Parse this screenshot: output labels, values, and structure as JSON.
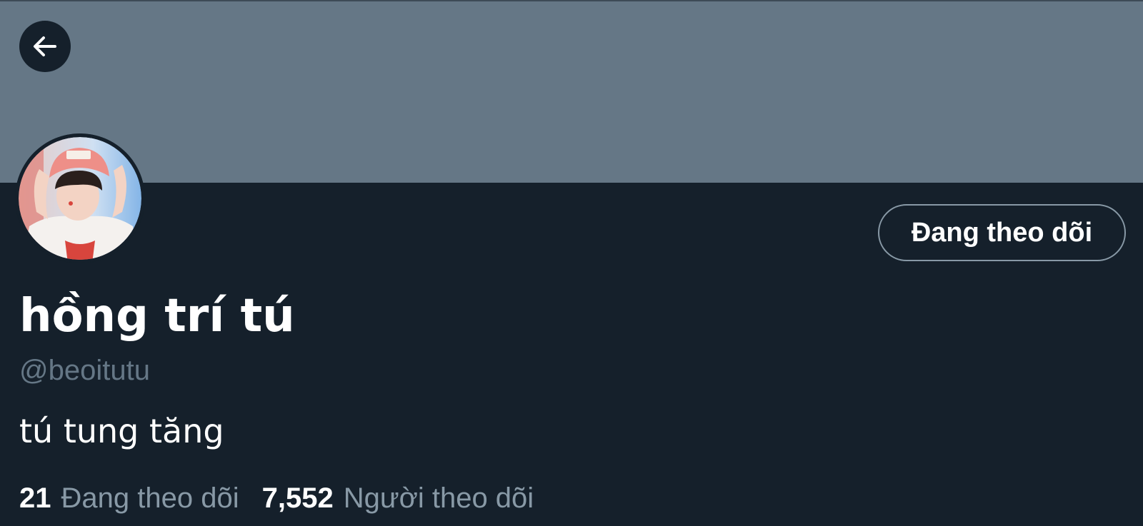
{
  "profile": {
    "display_name": "hồng trí tú",
    "handle": "@beoitutu",
    "bio": "tú tung tăng",
    "follow_button_label": "Đang theo dõi"
  },
  "stats": {
    "following_count": "21",
    "following_label": "Đang theo dõi",
    "followers_count": "7,552",
    "followers_label": "Người theo dõi"
  },
  "icons": {
    "back": "arrow-left-icon"
  },
  "colors": {
    "background": "#15202b",
    "banner": "#657786",
    "text_primary": "#ffffff",
    "text_secondary": "#8899a6",
    "button_border": "#8899a6"
  }
}
